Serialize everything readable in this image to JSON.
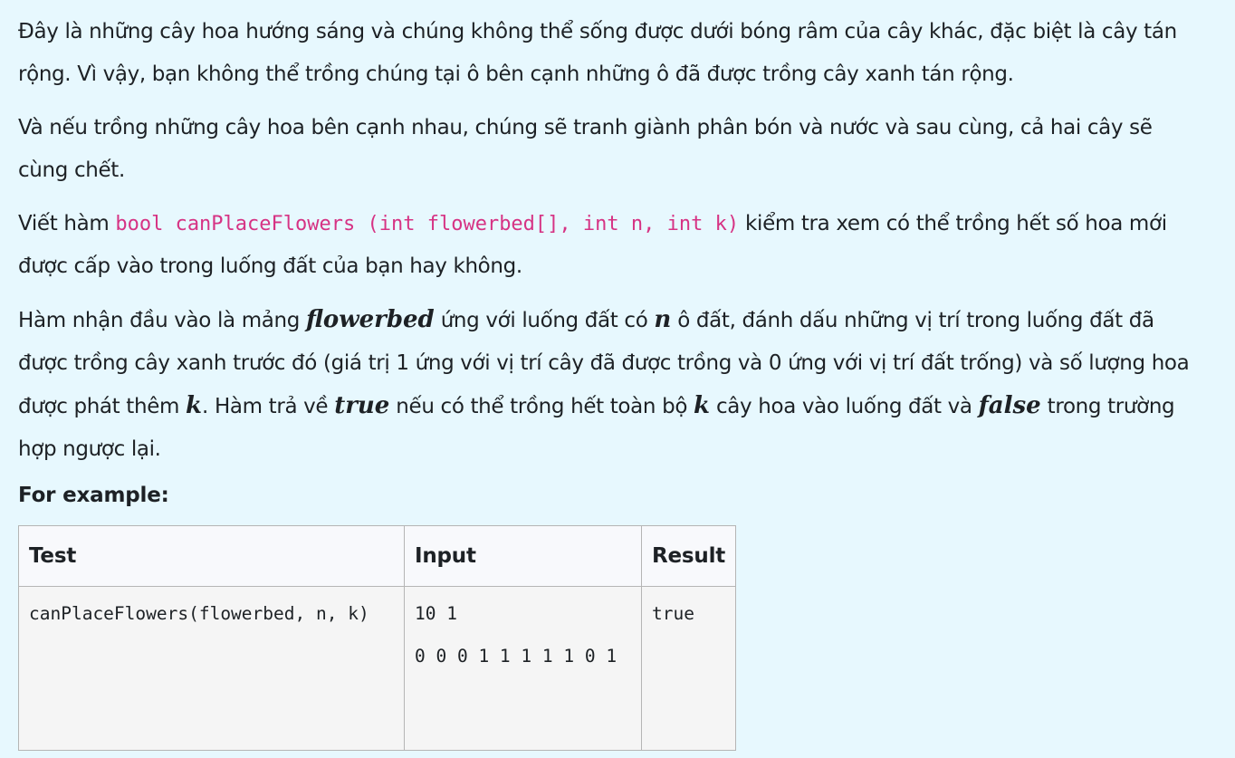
{
  "paragraphs": {
    "p1": "Đây là những cây hoa hướng sáng và chúng không thể sống được dưới bóng râm của cây khác, đặc biệt là cây tán rộng. Vì vậy, bạn không thể trồng chúng tại ô bên cạnh những ô đã được trồng cây xanh tán rộng.",
    "p2": "Và nếu trồng những cây hoa bên cạnh nhau, chúng sẽ tranh giành phân bón và nước và sau cùng, cả hai cây sẽ cùng chết.",
    "p3": {
      "before": "Viết hàm ",
      "code": "bool canPlaceFlowers (int flowerbed[], int n, int k)",
      "after": " kiểm tra xem có thể trồng hết số hoa mới được cấp vào trong luống đất của bạn hay không."
    },
    "p4": {
      "t1": "Hàm nhận đầu vào là mảng ",
      "m1": "flowerbed",
      "t2": " ứng với luống đất có ",
      "m2": "n",
      "t3": " ô đất, đánh dấu những vị trí trong luống đất đã được trồng cây xanh trước đó (giá trị 1 ứng với vị trí cây đã được trồng và 0 ứng với vị trí đất trống) và số lượng hoa được phát thêm ",
      "m3": "k",
      "t4": ". Hàm trả về ",
      "m4": "true",
      "t5": " nếu có thể trồng hết toàn bộ ",
      "m5": "k",
      "t6": " cây hoa vào luống đất và ",
      "m6": "false",
      "t7": " trong trường hợp ngược lại."
    }
  },
  "example": {
    "heading": "For example:",
    "headers": {
      "test": "Test",
      "input": "Input",
      "result": "Result"
    },
    "rows": [
      {
        "test": "canPlaceFlowers(flowerbed, n, k)",
        "input": "10 1\n0 0 0 1 1 1 1 1 0 1",
        "result": "true"
      }
    ]
  }
}
